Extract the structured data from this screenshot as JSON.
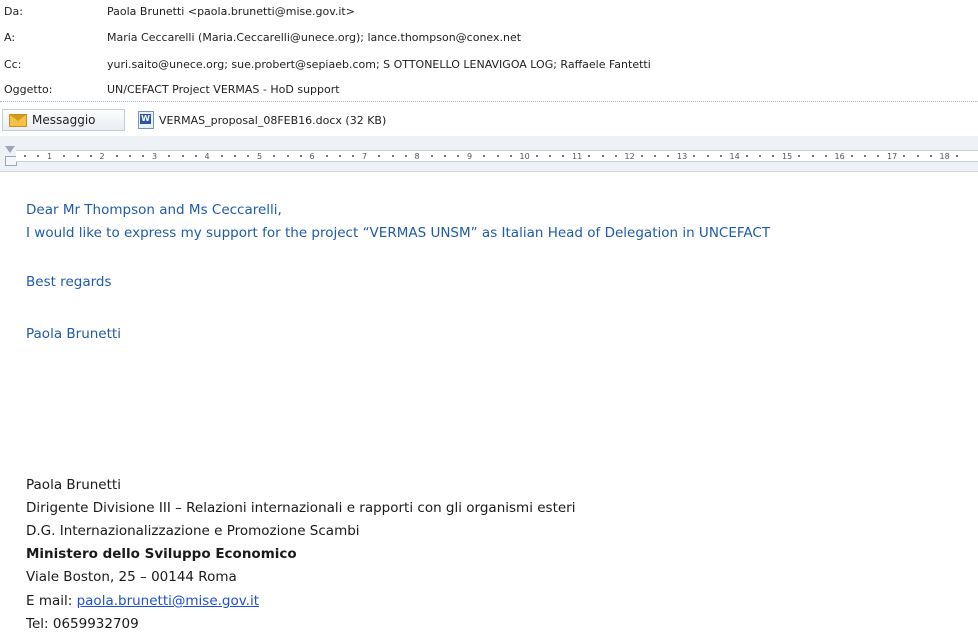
{
  "header": {
    "from_label": "Da:",
    "from_value": "Paola Brunetti <paola.brunetti@mise.gov.it>",
    "to_label": "A:",
    "to_value": "Maria Ceccarelli (Maria.Ceccarelli@unece.org); lance.thompson@conex.net",
    "cc_label": "Cc:",
    "cc_value": "yuri.saito@unece.org; sue.probert@sepiaeb.com; S OTTONELLO LENAVIGOA LOG; Raffaele Fantetti",
    "subject_label": "Oggetto:",
    "subject_value": "UN/CEFACT Project VERMAS - HoD support"
  },
  "tabs": {
    "message_label": "Messaggio",
    "attachment_label": "VERMAS_proposal_08FEB16.docx (32 KB)",
    "message_icon": "envelope-icon",
    "attachment_icon": "word-doc-icon"
  },
  "ruler": {
    "numbers": [
      "1",
      "2",
      "3",
      "4",
      "5",
      "6",
      "7",
      "8",
      "9",
      "10",
      "11",
      "12",
      "13",
      "14",
      "15",
      "16",
      "17",
      "18"
    ]
  },
  "body": {
    "greeting": "Dear Mr Thompson and Ms Ceccarelli,",
    "line1": "I would like to express my support for the project “VERMAS UNSM” as Italian Head of Delegation in UNCEFACT",
    "closing": "Best regards",
    "signoff": "Paola Brunetti"
  },
  "signature": {
    "name": "Paola Brunetti",
    "title": "Dirigente Divisione III – Relazioni internazionali e rapporti con gli organismi esteri",
    "dept": "D.G. Internazionalizzazione e Promozione Scambi",
    "ministry": "Ministero dello Sviluppo Economico",
    "address": "Viale Boston, 25 – 00144 Roma",
    "email_label": "E mail: ",
    "email": "paola.brunetti@mise.gov.it",
    "tel": "Tel: 0659932709"
  },
  "colors": {
    "body_text": "#1f5ba8",
    "link": "#1f4fd8",
    "ruler_bg": "#eef2f7"
  }
}
